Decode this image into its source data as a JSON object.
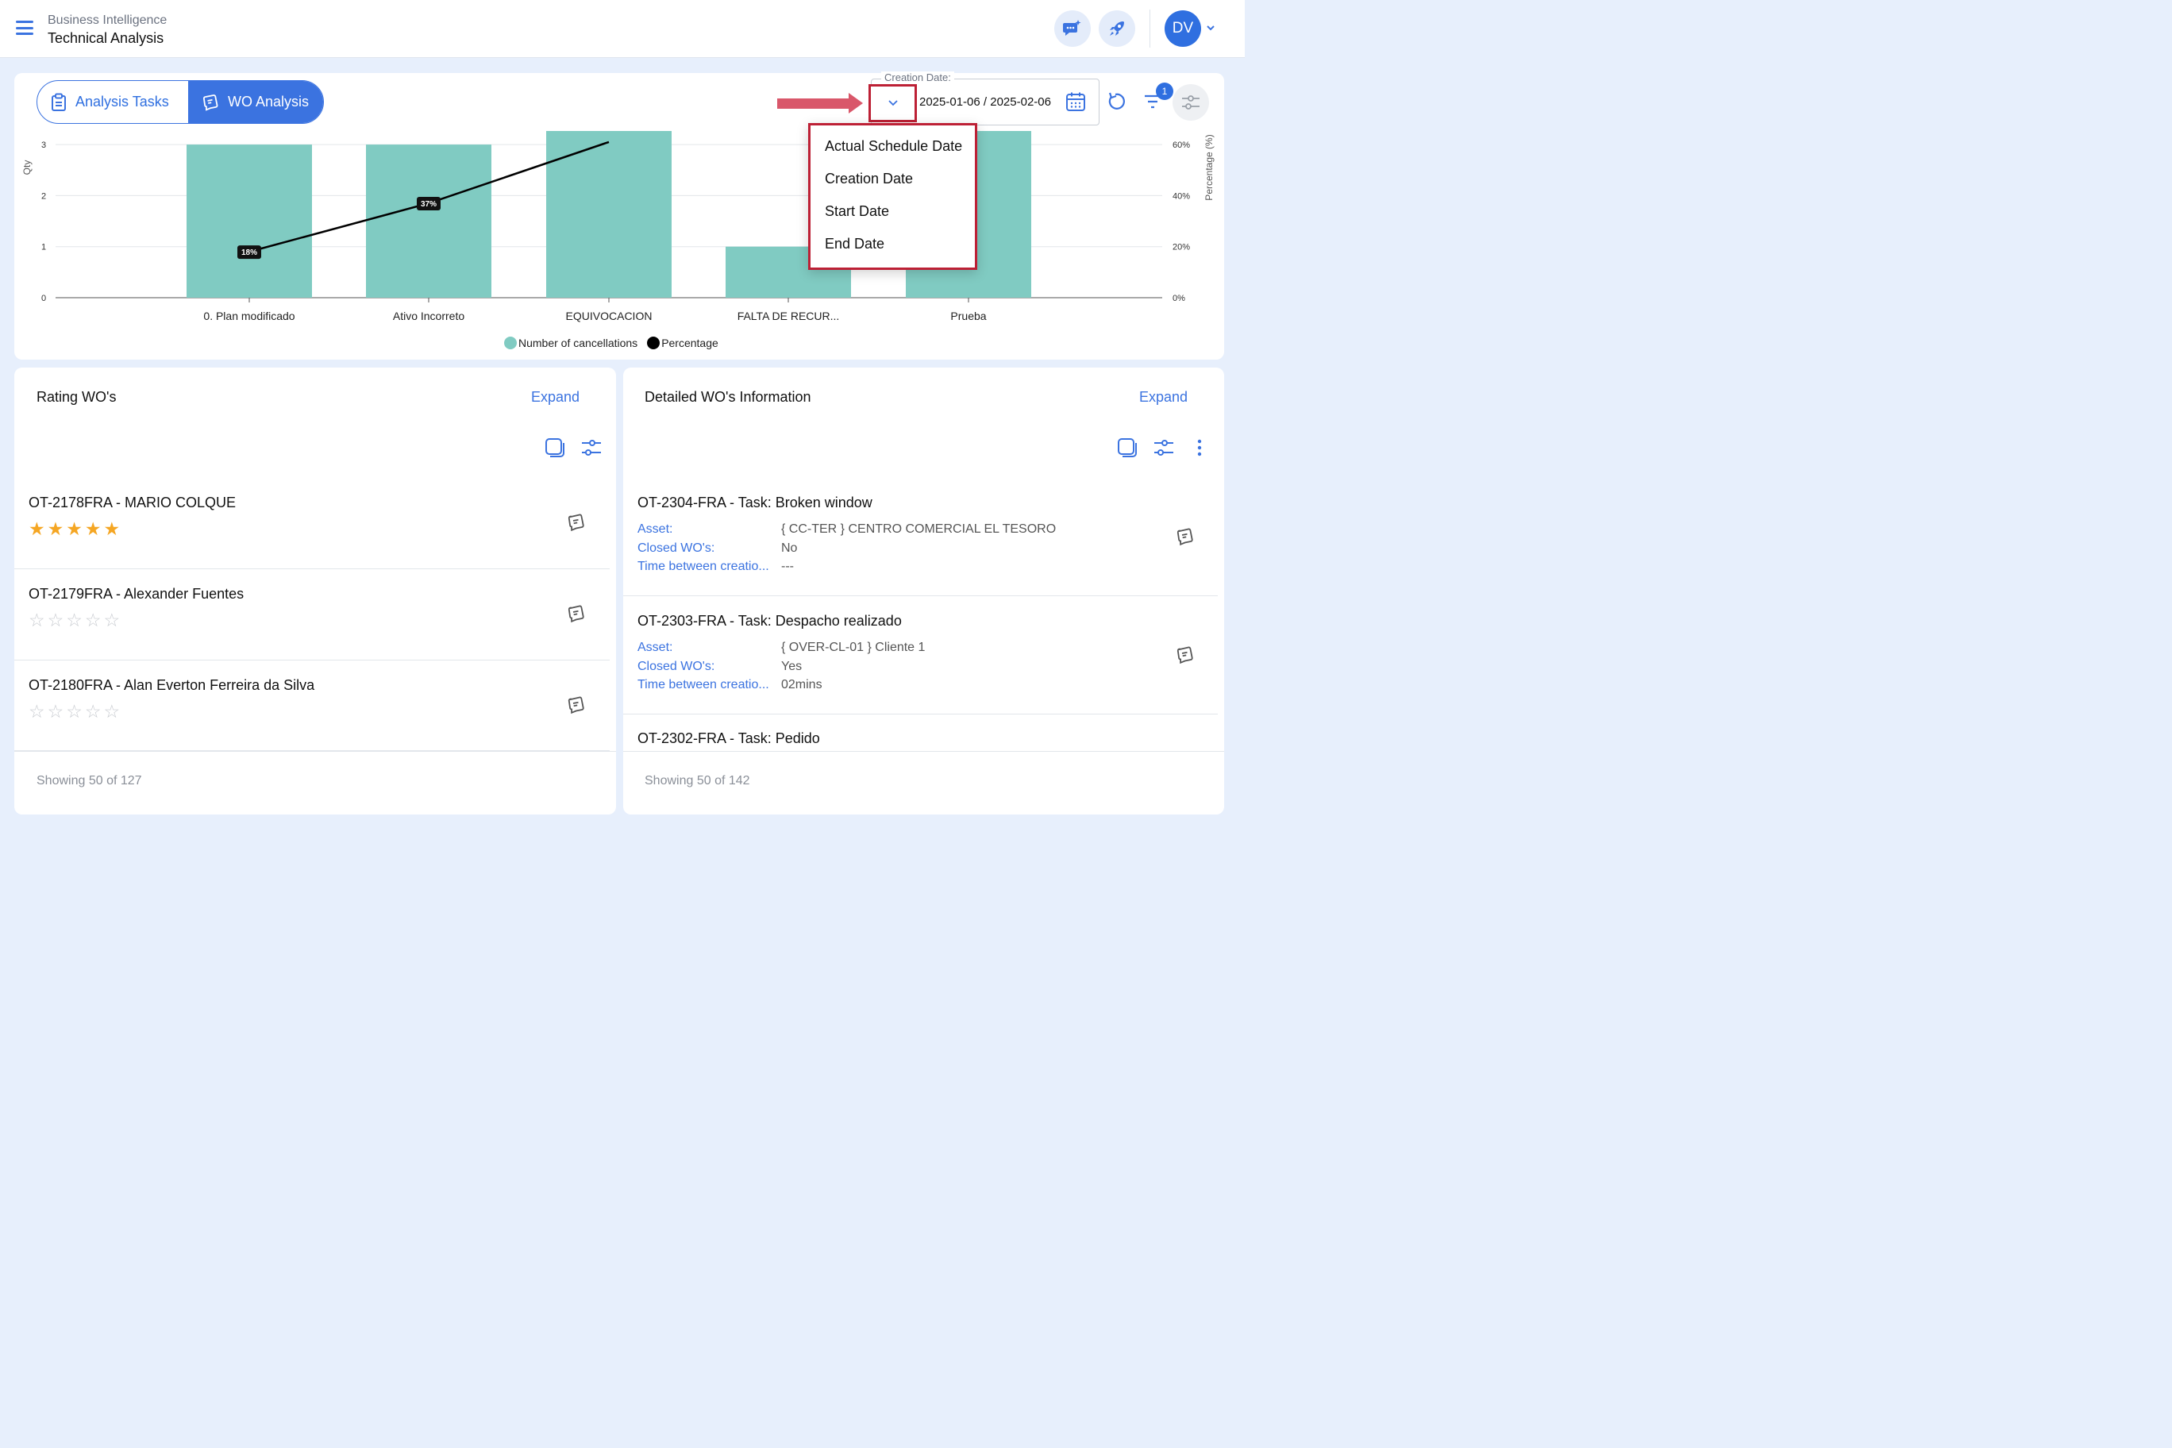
{
  "header": {
    "breadcrumb_parent": "Business Intelligence",
    "breadcrumb_title": "Technical Analysis",
    "avatar_initials": "DV"
  },
  "toolbar": {
    "tabs": [
      {
        "label": "Analysis Tasks",
        "active": false
      },
      {
        "label": "WO Analysis",
        "active": true
      }
    ],
    "date_field_label": "Creation Date:",
    "date_range": "2025-01-06 / 2025-02-06",
    "filter_count": "1"
  },
  "date_type_menu": {
    "items": [
      "Actual Schedule Date",
      "Creation Date",
      "Start Date",
      "End Date"
    ]
  },
  "chart_data": {
    "type": "bar",
    "categories": [
      "0. Plan modificado",
      "Ativo Incorreto",
      "EQUIVOCACION",
      "FALTA DE RECUR...",
      "Prueba"
    ],
    "series": [
      {
        "name": "Number of cancellations",
        "type": "bar",
        "color": "#80cbc2",
        "values": [
          3,
          3,
          3.3,
          1,
          3.3
        ]
      },
      {
        "name": "Percentage",
        "type": "line",
        "color": "#000000",
        "axis": "right",
        "values": [
          18,
          37,
          61,
          null,
          null
        ]
      }
    ],
    "point_labels": [
      "18%",
      "37%"
    ],
    "ylabel": "Qty",
    "ylabel_right": "Percentage (%)",
    "y_ticks": [
      "0",
      "1",
      "2",
      "3"
    ],
    "y_right_ticks": [
      "0%",
      "20%",
      "40%",
      "60%"
    ],
    "ylim": [
      0,
      3
    ],
    "ylim_right": [
      0,
      60
    ],
    "legend_position": "bottom"
  },
  "rating_card": {
    "title": "Rating WO's",
    "expand_label": "Expand",
    "items": [
      {
        "title": "OT-2178FRA - MARIO COLQUE",
        "rating": 5
      },
      {
        "title": "OT-2179FRA - Alexander Fuentes",
        "rating": 0
      },
      {
        "title": "OT-2180FRA - Alan Everton Ferreira da Silva",
        "rating": 0
      }
    ],
    "showing": "Showing 50 of 127"
  },
  "detail_card": {
    "title": "Detailed WO's Information",
    "expand_label": "Expand",
    "field_labels": {
      "asset": "Asset:",
      "closed": "Closed WO's:",
      "time": "Time between creatio..."
    },
    "items": [
      {
        "title": "OT-2304-FRA - Task: Broken window",
        "asset": "{ CC-TER } CENTRO COMERCIAL EL TESORO",
        "closed": "No",
        "time": "---"
      },
      {
        "title": "OT-2303-FRA - Task: Despacho realizado",
        "asset": "{ OVER-CL-01 } Cliente 1",
        "closed": "Yes",
        "time": "02mins"
      },
      {
        "title": "OT-2302-FRA - Task: Pedido"
      }
    ],
    "showing": "Showing 50 of 142"
  },
  "colors": {
    "primary": "#3b73e0",
    "bar": "#80cbc2",
    "highlight": "#bd2035",
    "arrow": "#d9576a",
    "star": "#f5a623"
  }
}
